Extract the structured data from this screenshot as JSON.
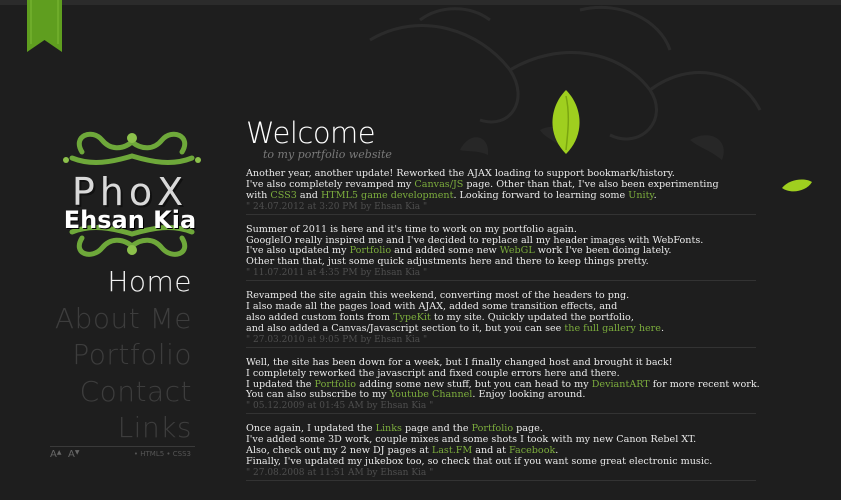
{
  "logo": {
    "line1": "PhoX",
    "line2": "Ehsan Kia"
  },
  "nav": [
    {
      "label": "Home",
      "active": true
    },
    {
      "label": "About Me",
      "active": false
    },
    {
      "label": "Portfolio",
      "active": false
    },
    {
      "label": "Contact",
      "active": false
    },
    {
      "label": "Links",
      "active": false
    }
  ],
  "font_controls": {
    "increase": "A",
    "decrease": "A"
  },
  "standards": "• HTML5 • CSS3",
  "header": {
    "title": "Welcome",
    "subtitle": "to my portfolio website"
  },
  "posts": [
    {
      "lines": [
        [
          {
            "t": "Another year, another update! Reworked the AJAX loading to support bookmark/history."
          }
        ],
        [
          {
            "t": "I've also completely revamped my "
          },
          {
            "t": "Canvas/JS",
            "link": true
          },
          {
            "t": " page. Other than that, I've also been experimenting"
          }
        ],
        [
          {
            "t": "with "
          },
          {
            "t": "CSS3",
            "link": true
          },
          {
            "t": " and "
          },
          {
            "t": "HTML5 game development",
            "link": true
          },
          {
            "t": ". Looking forward to learning some "
          },
          {
            "t": "Unity",
            "link": true
          },
          {
            "t": "."
          }
        ]
      ],
      "meta": "\" 24.07.2012 at 3:20 PM by Ehsan Kia \""
    },
    {
      "lines": [
        [
          {
            "t": "Summer of 2011 is here and it's time to work on my portfolio again."
          }
        ],
        [
          {
            "t": "GoogleIO really inspired me and I've decided to replace all my header images with WebFonts."
          }
        ],
        [
          {
            "t": "I've also updated my "
          },
          {
            "t": "Portfolio",
            "link": true
          },
          {
            "t": " and added some new "
          },
          {
            "t": "WebGL",
            "link": true
          },
          {
            "t": " work I've been doing lately."
          }
        ],
        [
          {
            "t": "Other than that, just some quick adjustments here and there to keep things pretty."
          }
        ]
      ],
      "meta": "\" 11.07.2011 at 4:35 PM by Ehsan Kia \""
    },
    {
      "lines": [
        [
          {
            "t": "Revamped the site again this weekend, converting most of the headers to png."
          }
        ],
        [
          {
            "t": "I also made all the pages load with AJAX, added some transition effects, and"
          }
        ],
        [
          {
            "t": "also added custom fonts from "
          },
          {
            "t": "TypeKit",
            "link": true
          },
          {
            "t": " to my site. Quickly updated the portfolio,"
          }
        ],
        [
          {
            "t": "and also added a Canvas/Javascript section to it, but you can see "
          },
          {
            "t": "the full gallery here",
            "link": true
          },
          {
            "t": "."
          }
        ]
      ],
      "meta": "\" 27.03.2010 at 9:05 PM by Ehsan Kia \""
    },
    {
      "lines": [
        [
          {
            "t": "Well, the site has been down for a week, but I finally changed host and brought it back!"
          }
        ],
        [
          {
            "t": "I completely reworked the javascript and fixed couple errors here and there."
          }
        ],
        [
          {
            "t": "I updated the "
          },
          {
            "t": "Portfolio",
            "link": true
          },
          {
            "t": " adding some new stuff, but you can head to my "
          },
          {
            "t": "DeviantART",
            "link": true
          },
          {
            "t": " for more recent work."
          }
        ],
        [
          {
            "t": "You can also subscribe to my "
          },
          {
            "t": "Youtube Channel",
            "link": true
          },
          {
            "t": ". Enjoy looking around."
          }
        ]
      ],
      "meta": "\" 05.12.2009 at 01:45 AM by Ehsan Kia \""
    },
    {
      "lines": [
        [
          {
            "t": "Once again, I updated the "
          },
          {
            "t": "Links",
            "link": true
          },
          {
            "t": " page and the "
          },
          {
            "t": "Portfolio",
            "link": true
          },
          {
            "t": " page."
          }
        ],
        [
          {
            "t": "I've added some 3D work, couple mixes and some shots I took with my new Canon Rebel XT."
          }
        ],
        [
          {
            "t": "Also, check out my 2 new DJ pages at "
          },
          {
            "t": "Last.FM",
            "link": true
          },
          {
            "t": " and at "
          },
          {
            "t": "Facebook",
            "link": true
          },
          {
            "t": "."
          }
        ],
        [
          {
            "t": "Finally, I've updated my jukebox too, so check that out if you want some great electronic music."
          }
        ]
      ],
      "meta": "\" 27.08.2008 at 11:51 AM by Ehsan Kia \""
    }
  ],
  "colors": {
    "background": "#1e1e1e",
    "accent": "#7cad3d",
    "nav_inactive": "#3d3d3d",
    "leaf": "#9fcf1f"
  }
}
